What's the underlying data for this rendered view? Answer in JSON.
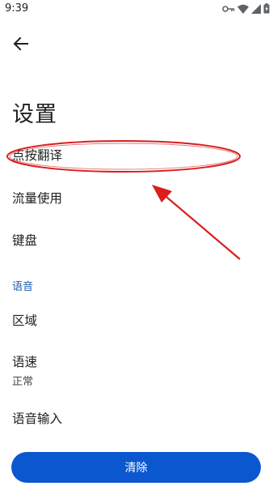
{
  "status_bar": {
    "time": "9:39",
    "icons": [
      "key-icon",
      "wifi-icon",
      "signal-icon",
      "battery-icon"
    ]
  },
  "header": {
    "back_icon": "arrow-left-icon",
    "title": "设置"
  },
  "settings": {
    "items": [
      {
        "label": "点按翻译"
      },
      {
        "label": "流量使用"
      },
      {
        "label": "键盘"
      }
    ],
    "voice_section": {
      "header": "语音",
      "items": [
        {
          "label": "区域"
        },
        {
          "label": "语速",
          "value": "正常"
        },
        {
          "label": "语音输入"
        }
      ]
    }
  },
  "footer": {
    "clear_label": "清除"
  },
  "colors": {
    "accent": "#0b57d0",
    "section_header": "#1a5fb4",
    "annotation": "#e02020"
  }
}
